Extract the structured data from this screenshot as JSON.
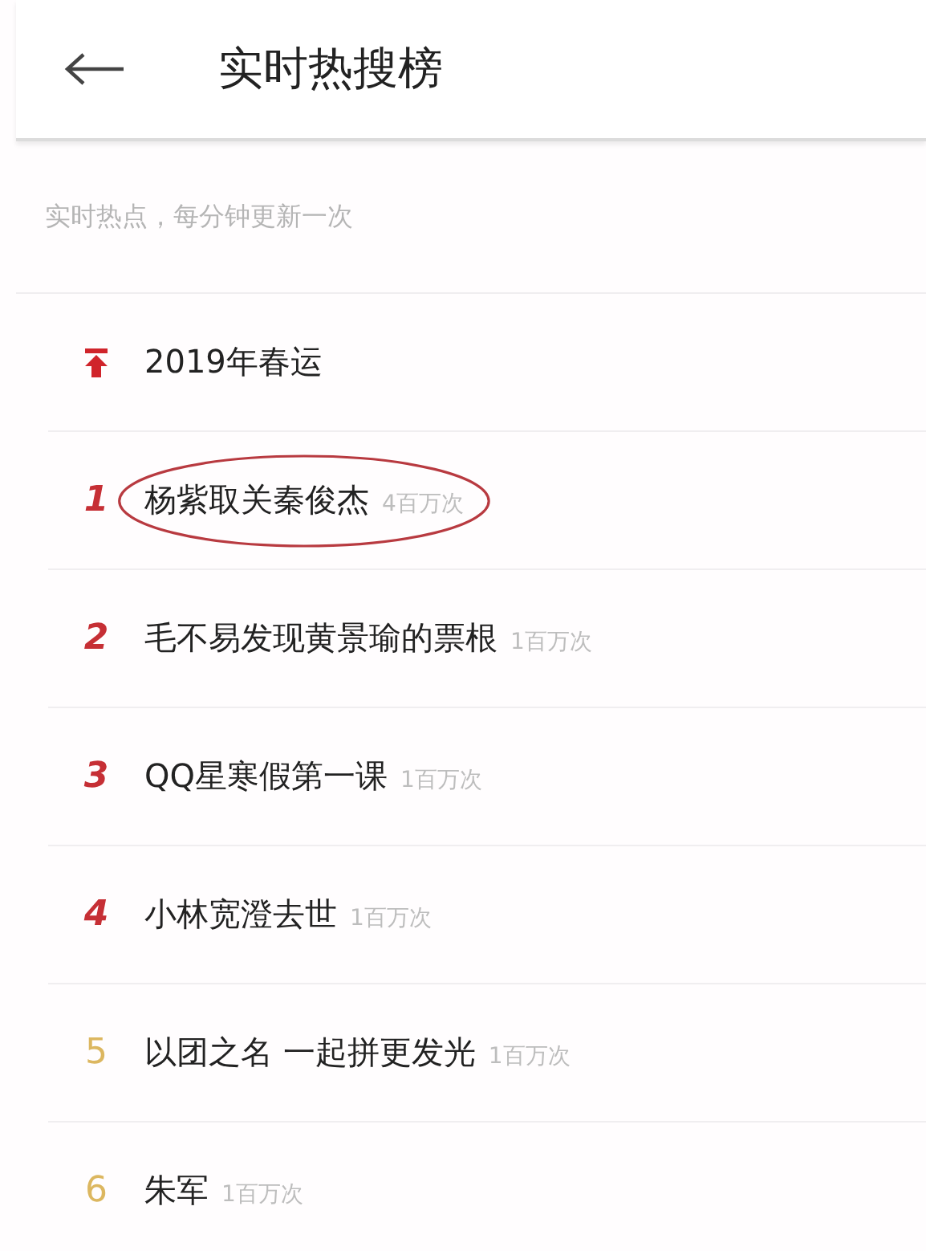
{
  "header": {
    "title": "实时热搜榜"
  },
  "subtitle": "实时热点，每分钟更新一次",
  "items": [
    {
      "kind": "pinned",
      "title": "2019年春运"
    },
    {
      "kind": "ranked",
      "rank": "1",
      "color": "#c62f35",
      "title": "杨紫取关秦俊杰",
      "count": "4百万次",
      "circled": true
    },
    {
      "kind": "ranked",
      "rank": "2",
      "color": "#c62f35",
      "title": "毛不易发现黄景瑜的票根",
      "count": "1百万次",
      "circled": false
    },
    {
      "kind": "ranked",
      "rank": "3",
      "color": "#c62f35",
      "title": "QQ星寒假第一课",
      "count": "1百万次",
      "circled": false
    },
    {
      "kind": "ranked",
      "rank": "4",
      "color": "#c62f35",
      "title": "小林宽澄去世",
      "count": "1百万次",
      "circled": false
    },
    {
      "kind": "plain",
      "rank": "5",
      "color": "#dcb760",
      "title": "以团之名 一起拼更发光",
      "count": "1百万次",
      "circled": false
    },
    {
      "kind": "plain",
      "rank": "6",
      "color": "#dcb760",
      "title": "朱军",
      "count": "1百万次",
      "circled": false
    }
  ]
}
